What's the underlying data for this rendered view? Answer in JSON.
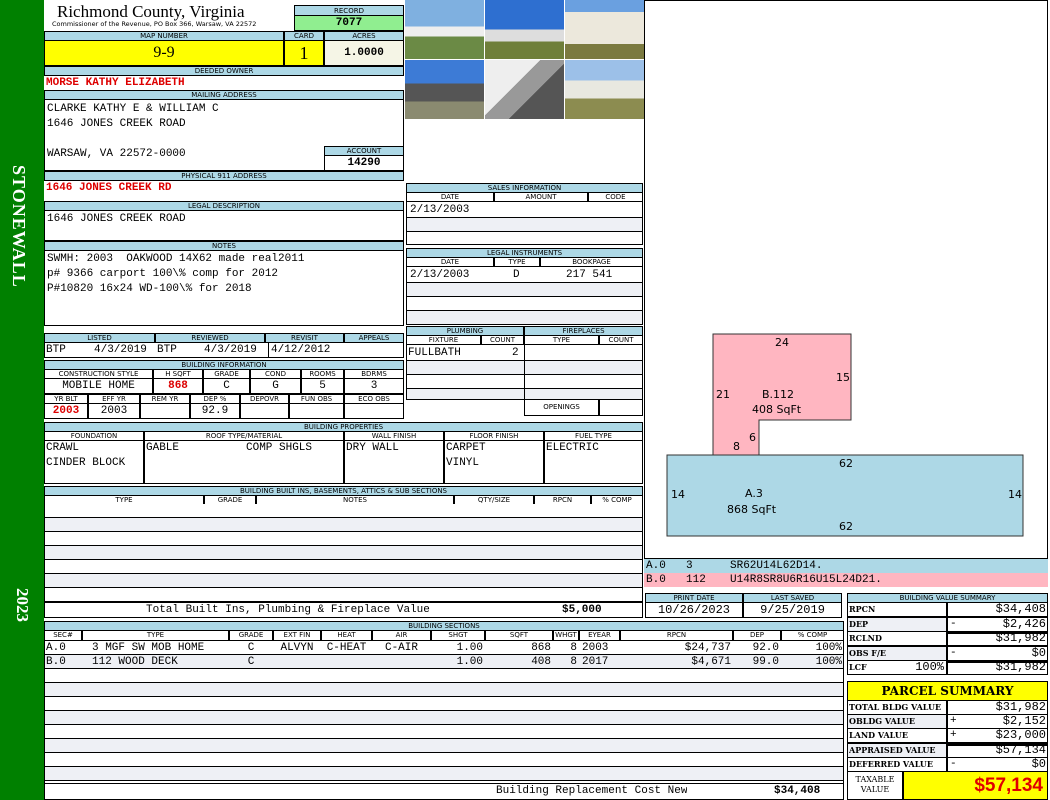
{
  "sidebar": {
    "district": "STONEWALL",
    "year": "2023",
    "color": "#008000"
  },
  "header": {
    "county": "Richmond County, Virginia",
    "office": "Commissioner of the Revenue, PO Box 366, Warsaw, VA 22572",
    "record_label": "RECORD",
    "record": "7077"
  },
  "parcel": {
    "map_label": "MAP NUMBER",
    "map": "9-9",
    "card_label": "CARD",
    "card": "1",
    "acres_label": "ACRES",
    "acres": "1.0000"
  },
  "owner": {
    "label": "DEEDED OWNER",
    "name": "MORSE KATHY ELIZABETH"
  },
  "mailing": {
    "label": "MAILING ADDRESS",
    "line1": "CLARKE KATHY E & WILLIAM C",
    "line2": "1646 JONES CREEK ROAD",
    "line3": "WARSAW, VA 22572-0000",
    "account_label": "ACCOUNT",
    "account": "14290"
  },
  "physical": {
    "label": "PHYSICAL 911 ADDRESS",
    "address": "1646 JONES CREEK RD"
  },
  "legal": {
    "label": "LEGAL DESCRIPTION",
    "text": "1646 JONES CREEK ROAD"
  },
  "notes": {
    "label": "NOTES",
    "line1": "SWMH: 2003  OAKWOOD 14X62 made real2011",
    "line2": "p# 9366 carport 100\\% comp for 2012",
    "line3": "P#10820 16x24 WD-100\\% for 2018"
  },
  "review": {
    "listed_label": "LISTED",
    "reviewed_label": "REVIEWED",
    "revisit_label": "REVISIT",
    "appeals_label": "APPEALS",
    "listed_by": "BTP",
    "listed": "4/3/2019",
    "reviewed_by": "BTP",
    "reviewed": "4/3/2019",
    "revisit": "4/12/2012",
    "appeals": ""
  },
  "building_info": {
    "label": "BUILDING INFORMATION",
    "h": [
      "CONSTRUCTION STYLE",
      "H SQFT",
      "GRADE",
      "COND",
      "ROOMS",
      "BDRMS"
    ],
    "v": [
      "MOBILE HOME",
      "868",
      "C",
      "G",
      "5",
      "3"
    ],
    "h2": [
      "YR BLT",
      "EFF YR",
      "REM YR",
      "DEP %",
      "DEPOVR",
      "FUN OBS",
      "ECO OBS"
    ],
    "v2": [
      "2003",
      "2003",
      "",
      "92.9",
      "",
      "",
      ""
    ]
  },
  "sales": {
    "label": "SALES INFORMATION",
    "h": [
      "DATE",
      "AMOUNT",
      "CODE"
    ],
    "date": "2/13/2003"
  },
  "instruments": {
    "label": "LEGAL INSTRUMENTS",
    "h": [
      "DATE",
      "TYPE",
      "BOOKPAGE"
    ],
    "date": "2/13/2003",
    "type": "D",
    "bookpage": "217 541"
  },
  "plumbing": {
    "label": "PLUMBING",
    "fixture_label": "FIXTURE",
    "count_label": "COUNT",
    "fixture": "FULLBATH",
    "count": "2"
  },
  "fireplaces": {
    "label": "FIREPLACES",
    "type_label": "TYPE",
    "count_label": "COUNT",
    "openings_label": "OPENINGS"
  },
  "properties": {
    "label": "BUILDING PROPERTIES",
    "h": [
      "FOUNDATION",
      "ROOF TYPE/MATERIAL",
      "WALL FINISH",
      "FLOOR FINISH",
      "FUEL TYPE"
    ],
    "foundation1": "CRAWL",
    "foundation2": "CINDER BLOCK",
    "roof_type": "GABLE",
    "roof_material": "COMP SHGLS",
    "wall": "DRY WALL",
    "floor1": "CARPET",
    "floor2": "VINYL",
    "fuel": "ELECTRIC"
  },
  "builtins": {
    "label": "BUILDING BUILT INS, BASEMENTS, ATTICS & SUB SECTIONS",
    "h": [
      "TYPE",
      "GRADE",
      "NOTES",
      "QTY/SIZE",
      "RPCN",
      "% COMP"
    ],
    "total_label": "Total Built Ins, Plumbing & Fireplace Value",
    "total": "$5,000"
  },
  "dates": {
    "print_label": "PRINT DATE",
    "print": "10/26/2023",
    "saved_label": "LAST SAVED",
    "saved": "9/25/2019"
  },
  "sections": {
    "label": "BUILDING SECTIONS",
    "h": [
      "SEC#",
      "TYPE",
      "GRADE",
      "EXT FIN",
      "HEAT",
      "AIR",
      "SHGT",
      "SQFT",
      "WHGT",
      "EYEAR",
      "RPCN",
      "DEP",
      "% COMP"
    ],
    "rows": [
      [
        "A.0",
        "3 MGF SW MOB HOME",
        "C",
        "ALVYN",
        "C-HEAT",
        "C-AIR",
        "1.00",
        "868",
        "8",
        "2003",
        "$24,737",
        "92.0",
        "100%"
      ],
      [
        "B.0",
        "112 WOOD DECK",
        "C",
        "",
        "",
        "",
        "1.00",
        "408",
        "8",
        "2017",
        "$4,671",
        "99.0",
        "100%"
      ]
    ],
    "replacement_label": "Building Replacement Cost New",
    "replacement": "$34,408"
  },
  "sketch": {
    "a_label": "A.3",
    "a_area": "868 SqFt",
    "b_label": "B.112",
    "b_area": "408 SqFt",
    "a_dims": [
      "62",
      "14",
      "14",
      "62"
    ],
    "b_dims": [
      "24",
      "15",
      "21",
      "6",
      "8"
    ],
    "a_color": "#add8e6",
    "b_color": "#ffb6c1",
    "legend": [
      {
        "sec": "A.0",
        "code": "3",
        "path": "SR62U14L62D14."
      },
      {
        "sec": "B.0",
        "code": "112",
        "path": "U14R8SR8U6R16U15L24D21."
      }
    ]
  },
  "value_summary": {
    "label": "BUILDING VALUE SUMMARY",
    "rpcn_label": "RPCN",
    "rpcn": "$34,408",
    "dep_label": "DEP",
    "dep_sign": "-",
    "dep": "$2,426",
    "rclnd_label": "RCLND",
    "rclnd": "$31,982",
    "obs_label": "OBS F/E",
    "obs_sign": "-",
    "obs": "$0",
    "lcf_label": "LCF",
    "lcf_pct": "100%",
    "lcf": "$31,982"
  },
  "parcel_summary": {
    "label": "PARCEL SUMMARY",
    "total_label": "TOTAL BLDG VALUE",
    "total": "$31,982",
    "obldg_label": "OBLDG VALUE",
    "obldg_sign": "+",
    "obldg": "$2,152",
    "land_label": "LAND VALUE",
    "land_sign": "+",
    "land": "$23,000",
    "appraised_label": "APPRAISED VALUE",
    "appraised": "$57,134",
    "deferred_label": "DEFERRED VALUE",
    "deferred_sign": "-",
    "deferred": "$0",
    "taxable_label": "TAXABLE VALUE",
    "taxable": "$57,134"
  }
}
